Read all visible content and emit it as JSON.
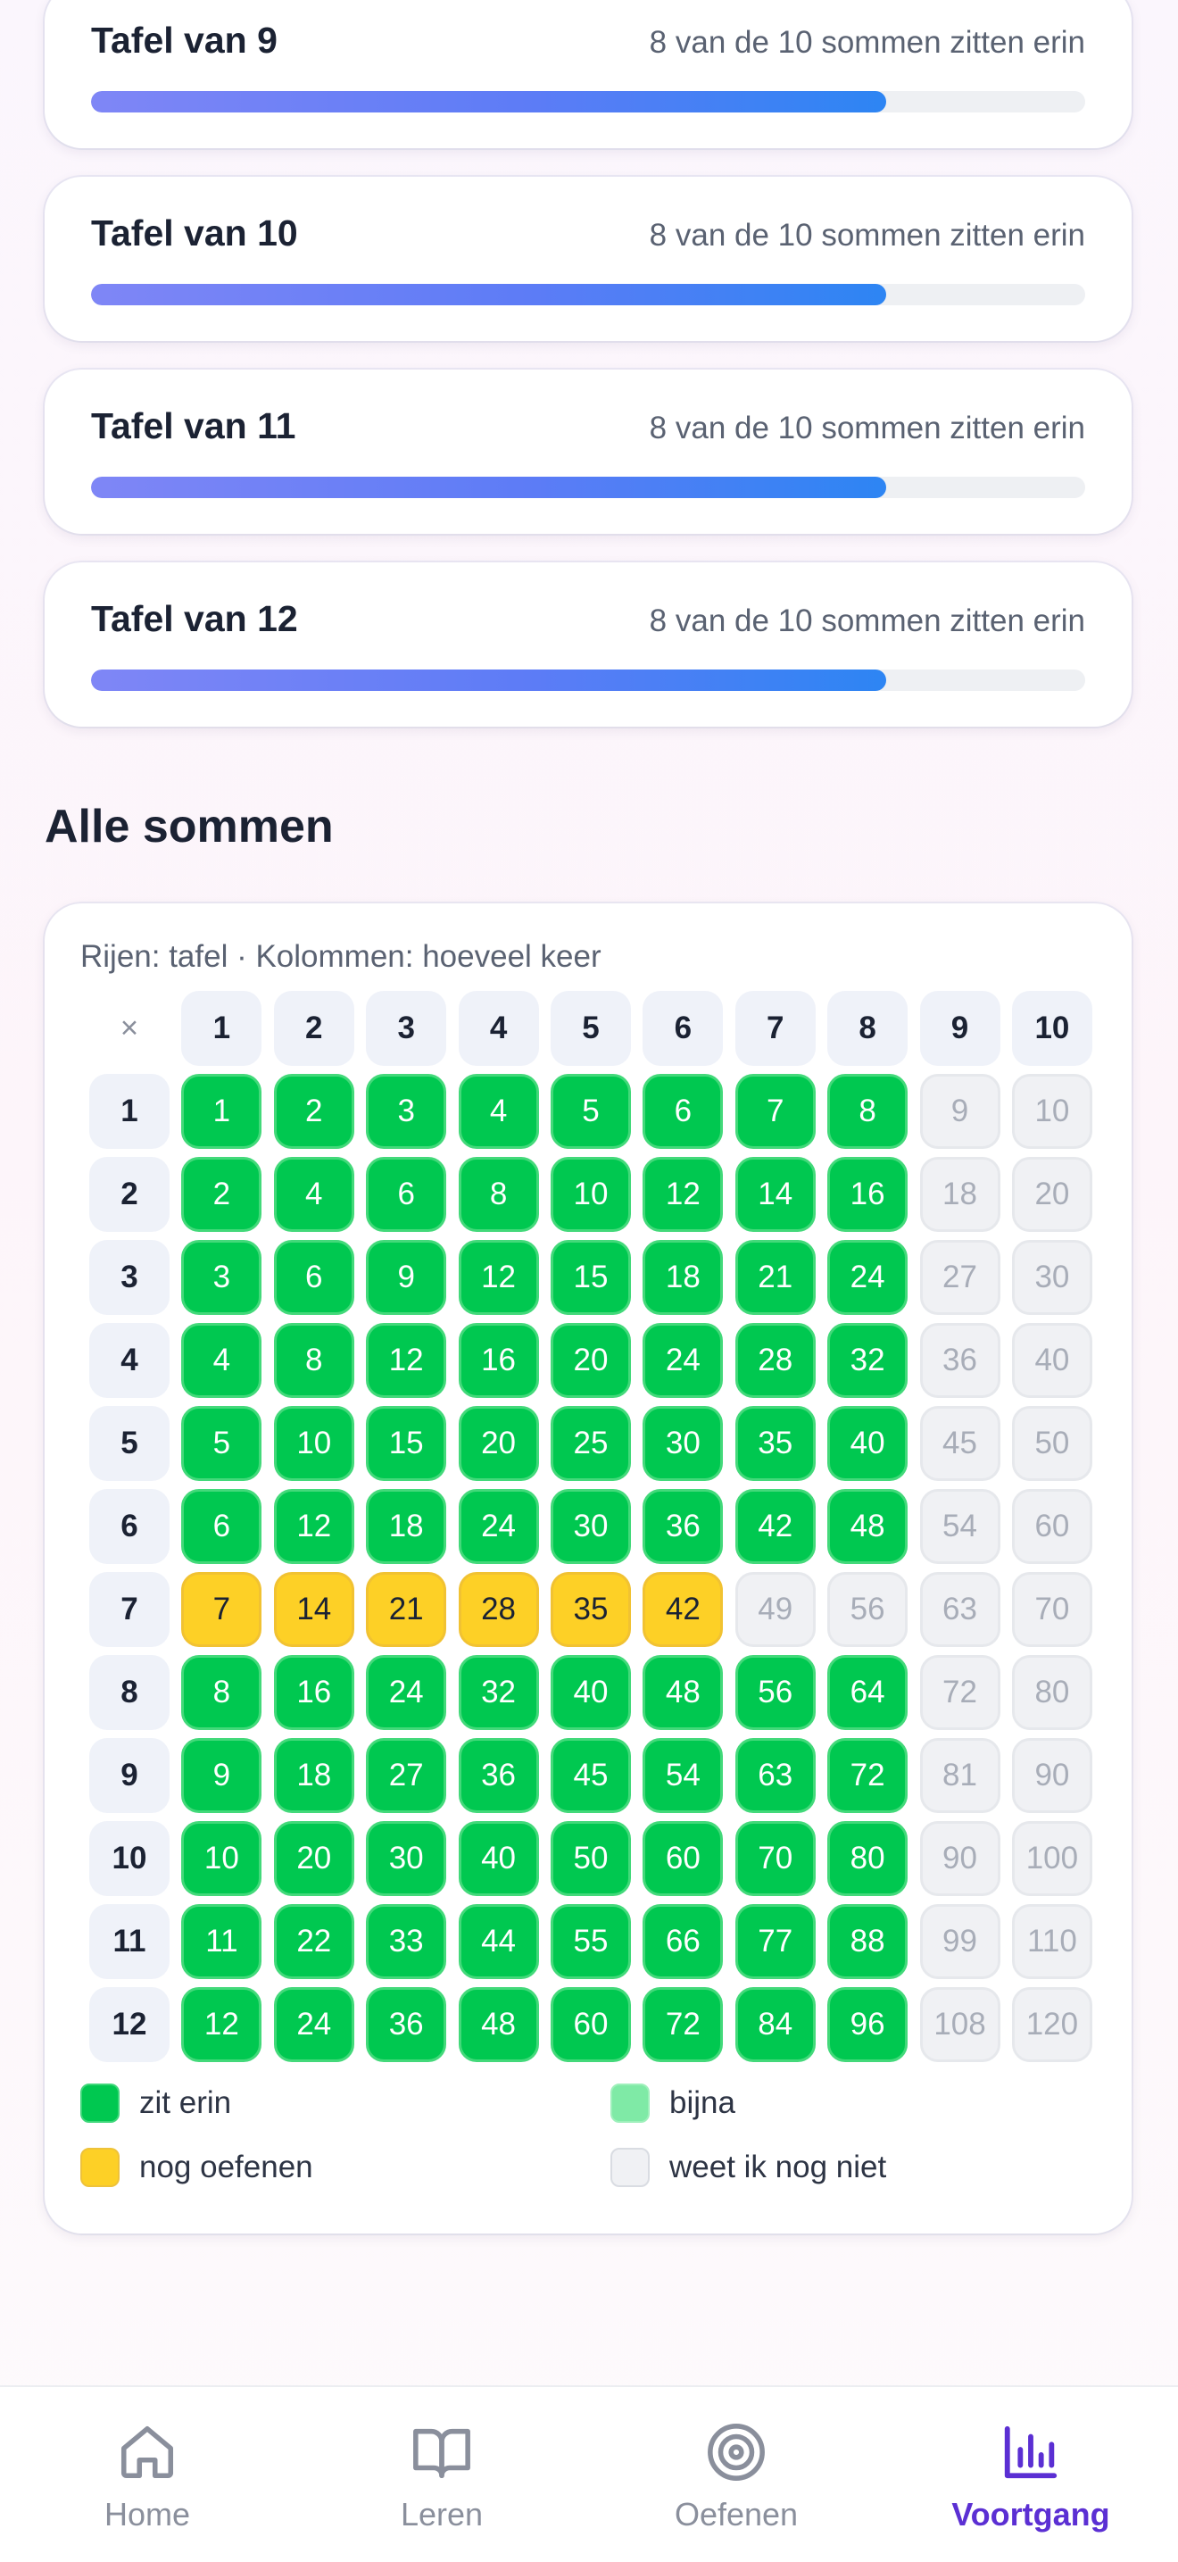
{
  "tables": [
    {
      "title": "Tafel van 9",
      "status": "8 van de 10 sommen zitten erin",
      "progress": 0.8
    },
    {
      "title": "Tafel van 10",
      "status": "8 van de 10 sommen zitten erin",
      "progress": 0.8
    },
    {
      "title": "Tafel van 11",
      "status": "8 van de 10 sommen zitten erin",
      "progress": 0.8
    },
    {
      "title": "Tafel van 12",
      "status": "8 van de 10 sommen zitten erin",
      "progress": 0.8
    }
  ],
  "overview": {
    "title": "Alle sommen",
    "caption": "Rijen: tafel · Kolommen: hoeveel keer",
    "corner": "×",
    "columns": [
      "1",
      "2",
      "3",
      "4",
      "5",
      "6",
      "7",
      "8",
      "9",
      "10"
    ],
    "rows": [
      {
        "label": "1",
        "values": [
          "1",
          "2",
          "3",
          "4",
          "5",
          "6",
          "7",
          "8",
          "9",
          "10"
        ],
        "states": [
          "known",
          "known",
          "known",
          "known",
          "known",
          "known",
          "known",
          "known",
          "unknown",
          "unknown"
        ]
      },
      {
        "label": "2",
        "values": [
          "2",
          "4",
          "6",
          "8",
          "10",
          "12",
          "14",
          "16",
          "18",
          "20"
        ],
        "states": [
          "known",
          "known",
          "known",
          "known",
          "known",
          "known",
          "known",
          "known",
          "unknown",
          "unknown"
        ]
      },
      {
        "label": "3",
        "values": [
          "3",
          "6",
          "9",
          "12",
          "15",
          "18",
          "21",
          "24",
          "27",
          "30"
        ],
        "states": [
          "known",
          "known",
          "known",
          "known",
          "known",
          "known",
          "known",
          "known",
          "unknown",
          "unknown"
        ]
      },
      {
        "label": "4",
        "values": [
          "4",
          "8",
          "12",
          "16",
          "20",
          "24",
          "28",
          "32",
          "36",
          "40"
        ],
        "states": [
          "known",
          "known",
          "known",
          "known",
          "known",
          "known",
          "known",
          "known",
          "unknown",
          "unknown"
        ]
      },
      {
        "label": "5",
        "values": [
          "5",
          "10",
          "15",
          "20",
          "25",
          "30",
          "35",
          "40",
          "45",
          "50"
        ],
        "states": [
          "known",
          "known",
          "known",
          "known",
          "known",
          "known",
          "known",
          "known",
          "unknown",
          "unknown"
        ]
      },
      {
        "label": "6",
        "values": [
          "6",
          "12",
          "18",
          "24",
          "30",
          "36",
          "42",
          "48",
          "54",
          "60"
        ],
        "states": [
          "known",
          "known",
          "known",
          "known",
          "known",
          "known",
          "known",
          "known",
          "unknown",
          "unknown"
        ]
      },
      {
        "label": "7",
        "values": [
          "7",
          "14",
          "21",
          "28",
          "35",
          "42",
          "49",
          "56",
          "63",
          "70"
        ],
        "states": [
          "practice",
          "practice",
          "practice",
          "practice",
          "practice",
          "practice",
          "unknown",
          "unknown",
          "unknown",
          "unknown"
        ]
      },
      {
        "label": "8",
        "values": [
          "8",
          "16",
          "24",
          "32",
          "40",
          "48",
          "56",
          "64",
          "72",
          "80"
        ],
        "states": [
          "known",
          "known",
          "known",
          "known",
          "known",
          "known",
          "known",
          "known",
          "unknown",
          "unknown"
        ]
      },
      {
        "label": "9",
        "values": [
          "9",
          "18",
          "27",
          "36",
          "45",
          "54",
          "63",
          "72",
          "81",
          "90"
        ],
        "states": [
          "known",
          "known",
          "known",
          "known",
          "known",
          "known",
          "known",
          "known",
          "unknown",
          "unknown"
        ]
      },
      {
        "label": "10",
        "values": [
          "10",
          "20",
          "30",
          "40",
          "50",
          "60",
          "70",
          "80",
          "90",
          "100"
        ],
        "states": [
          "known",
          "known",
          "known",
          "known",
          "known",
          "known",
          "known",
          "known",
          "unknown",
          "unknown"
        ]
      },
      {
        "label": "11",
        "values": [
          "11",
          "22",
          "33",
          "44",
          "55",
          "66",
          "77",
          "88",
          "99",
          "110"
        ],
        "states": [
          "known",
          "known",
          "known",
          "known",
          "known",
          "known",
          "known",
          "known",
          "unknown",
          "unknown"
        ]
      },
      {
        "label": "12",
        "values": [
          "12",
          "24",
          "36",
          "48",
          "60",
          "72",
          "84",
          "96",
          "108",
          "120"
        ],
        "states": [
          "known",
          "known",
          "known",
          "known",
          "known",
          "known",
          "known",
          "known",
          "unknown",
          "unknown"
        ]
      }
    ],
    "legend": {
      "known": "zit erin",
      "almost": "bijna",
      "practice": "nog oefenen",
      "unknown": "weet ik nog niet"
    },
    "colors": {
      "known": "#00c850",
      "almost": "#7feaa6",
      "practice": "#fdd026",
      "unknown": "#f0f1f4"
    }
  },
  "nav": {
    "home": "Home",
    "learn": "Leren",
    "practice": "Oefenen",
    "progress": "Voortgang",
    "active": "progress",
    "icons": {
      "home": "home-icon",
      "learn": "book-icon",
      "practice": "target-icon",
      "progress": "bar-chart-icon"
    },
    "active_color": "#5b2fd3"
  }
}
